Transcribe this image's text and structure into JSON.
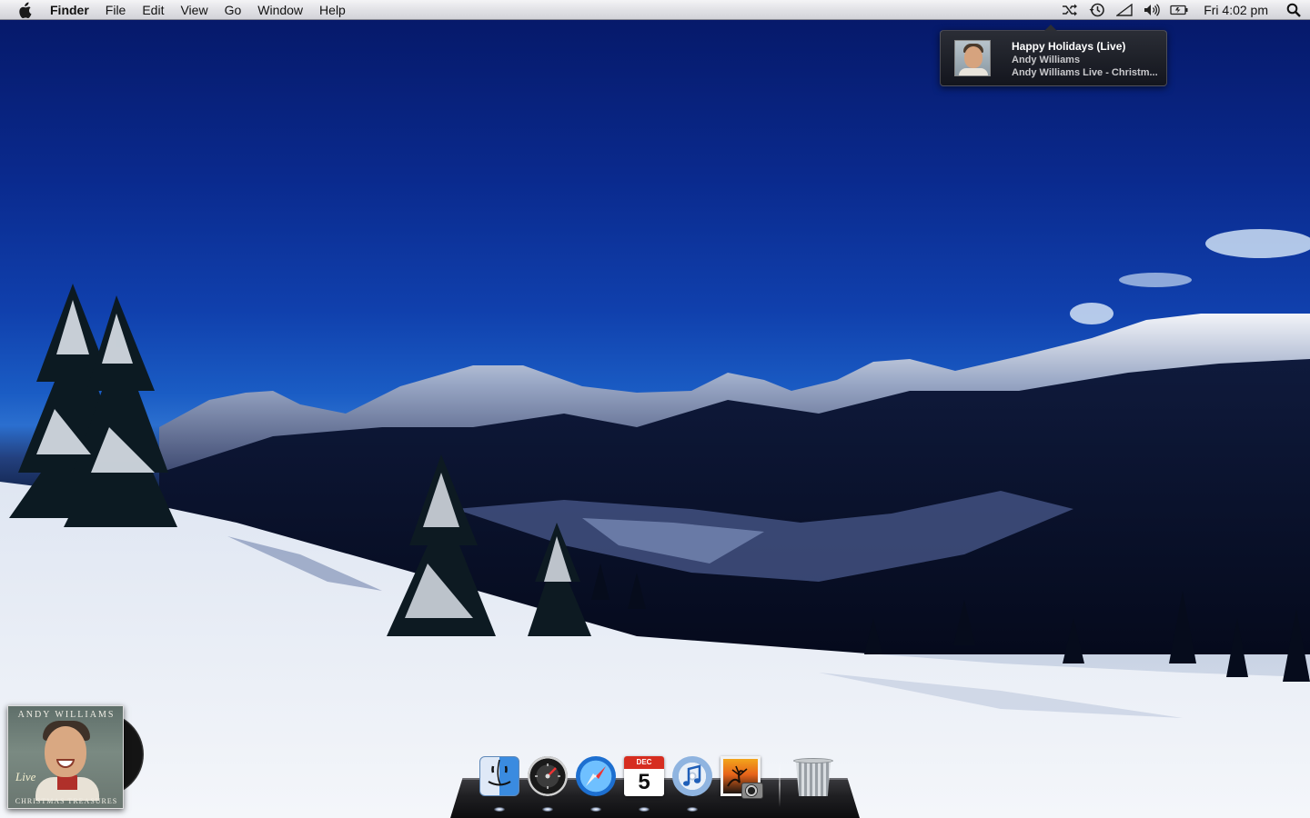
{
  "menubar": {
    "app_name": "Finder",
    "menus": [
      "File",
      "Edit",
      "View",
      "Go",
      "Window",
      "Help"
    ],
    "status_icons": [
      "shuffle-icon",
      "time-machine-icon",
      "wifi-signal-icon",
      "volume-icon",
      "battery-icon"
    ],
    "clock": "Fri 4:02 pm"
  },
  "now_playing": {
    "track": "Happy Holidays (Live)",
    "artist": "Andy Williams",
    "album": "Andy Williams Live - Christm..."
  },
  "album_widget": {
    "title": "ANDY WILLIAMS",
    "subtitle": "Live",
    "bottom": "CHRISTMAS TREASURES"
  },
  "dock": {
    "apps": [
      {
        "name": "Finder",
        "icon": "finder-icon",
        "running": true
      },
      {
        "name": "Dashboard",
        "icon": "dashboard-icon",
        "running": true
      },
      {
        "name": "Safari",
        "icon": "safari-icon",
        "running": true
      },
      {
        "name": "iCal",
        "icon": "ical-icon",
        "running": true,
        "month": "DEC",
        "day": "5"
      },
      {
        "name": "iTunes",
        "icon": "itunes-icon",
        "running": true
      },
      {
        "name": "iPhoto",
        "icon": "iphoto-icon",
        "running": false
      },
      {
        "name": "Trash",
        "icon": "trash-icon",
        "running": false
      }
    ]
  },
  "colors": {
    "sky_top": "#051766",
    "sky_bottom": "#2b6fcf",
    "snow": "#e9edf5",
    "menubar": "#e2e2e6"
  }
}
